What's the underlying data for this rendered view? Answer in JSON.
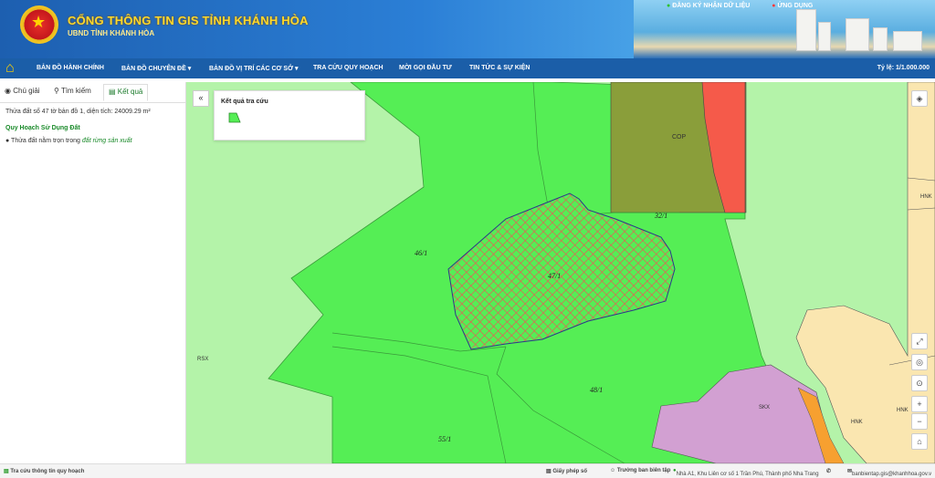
{
  "header": {
    "title": "CỔNG THÔNG TIN GIS TỈNH KHÁNH HÒA",
    "subtitle": "UBND TỈNH KHÁNH HÒA",
    "link_register": "ĐĂNG KÝ NHẬN DỮ LIỆU",
    "link_app": "ỨNG DỤNG",
    "emblem": "star-icon"
  },
  "nav": {
    "items": [
      "BẢN ĐỒ HÀNH CHÍNH",
      "BẢN ĐỒ CHUYÊN ĐỀ ▾",
      "BẢN ĐỒ VỊ TRÍ CÁC CƠ SỞ ▾",
      "TRA CỨU QUY HOẠCH",
      "MỜI GỌI ĐẦU TƯ",
      "TIN TỨC & SỰ KIỆN"
    ],
    "scale": "Tỷ lệ: 1/1.000.000"
  },
  "panel": {
    "tabs": [
      "Chú giải",
      "Tìm kiếm",
      "Kết quả"
    ],
    "active_tab": "Kết quả",
    "info": "Thửa đất số 47 tờ bản đồ 1, diện tích: 24009.29 m²",
    "section": "Quy Hoạch Sử Dụng Đất",
    "bullet_prefix": "Thửa đất nằm trọn trong",
    "bullet_link": "đất rừng sản xuất"
  },
  "legend": {
    "title": "Kết quả tra cứu"
  },
  "map": {
    "labels": {
      "cop": "COP",
      "p32": "32/1",
      "p46": "46/1",
      "p47": "47/1",
      "p48": "48/1",
      "p55": "55/1",
      "rsx": "RSX",
      "skx": "SKX",
      "hnk1": "HNK",
      "hnk2": "HNK",
      "hnk3": "HNK"
    },
    "colors": {
      "bg": "#b4f3a9",
      "parcel": "#55ee55",
      "hatch": "#ee5555",
      "cop_green": "#8a9e3a",
      "cop_red": "#f55a4a",
      "residential": "#fae6b0",
      "industrial": "#d2a0d2",
      "orange": "#f7a030"
    }
  },
  "footer": {
    "left": "Tra cứu thông tin quy hoạch",
    "license": "Giấy phép số",
    "editor": "Trưởng ban biên tập",
    "address": "Nhà A1, Khu Liên cơ số 1 Trần Phú, Thành phố Nha Trang",
    "email": "banbientap.gis@khanhhoa.gov.v"
  }
}
